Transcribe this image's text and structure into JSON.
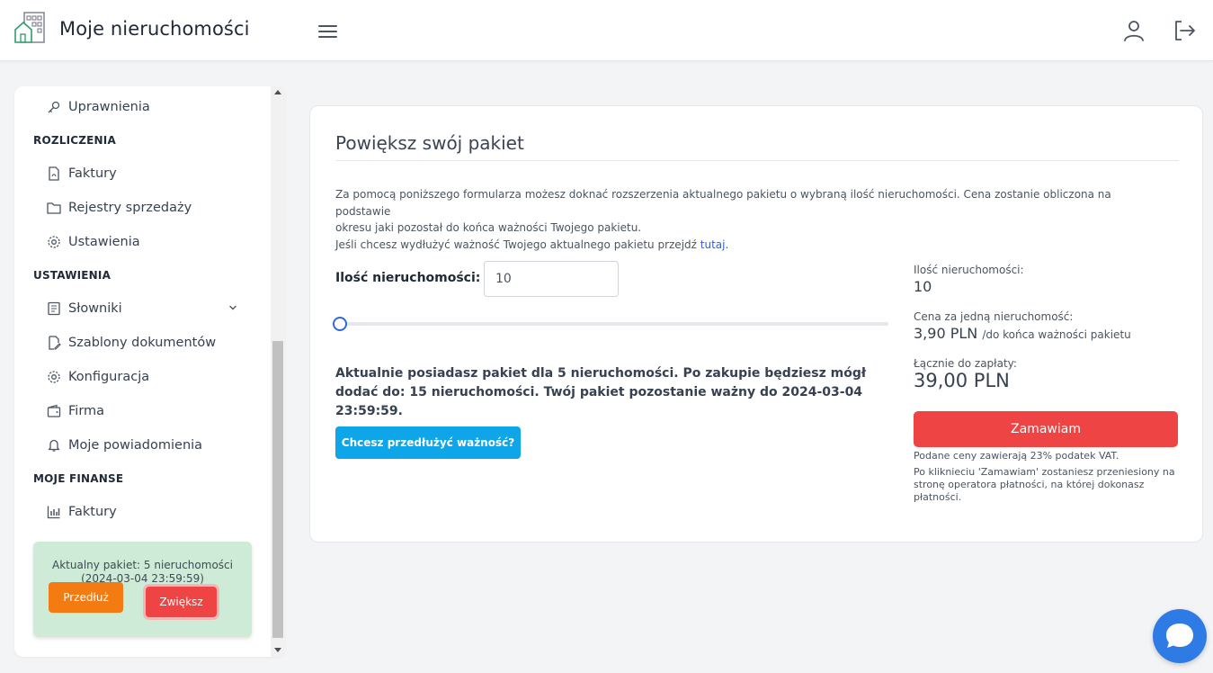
{
  "header": {
    "title": "Moje nieruchomości",
    "icons": [
      "building-logo-icon",
      "hamburger-menu-icon",
      "user-icon",
      "logout-icon"
    ]
  },
  "sidebar": {
    "items_top": [
      {
        "label": "Uprawnienia",
        "icon": "key-icon"
      }
    ],
    "sections": [
      {
        "title": "ROZLICZENIA",
        "items": [
          {
            "label": "Faktury",
            "icon": "pdf-file-icon"
          },
          {
            "label": "Rejestry sprzedaży",
            "icon": "folder-icon"
          },
          {
            "label": "Ustawienia",
            "icon": "gear-icon"
          }
        ]
      },
      {
        "title": "USTAWIENIA",
        "items": [
          {
            "label": "Słowniki",
            "icon": "book-icon"
          },
          {
            "label": "Szablony dokumentów",
            "icon": "document-edit-icon"
          },
          {
            "label": "Konfiguracja",
            "icon": "gear-icon"
          },
          {
            "label": "Firma",
            "icon": "wallet-icon"
          },
          {
            "label": "Moje powiadomienia",
            "icon": "bell-icon"
          }
        ]
      },
      {
        "title": "MOJE FINANSE",
        "items": [
          {
            "label": "Faktury",
            "icon": "bar-chart-icon"
          }
        ]
      }
    ],
    "package": {
      "line1": "Aktualny pakiet: 5 nieruchomości",
      "line2": "(2024-03-04 23:59:59)",
      "extend_label": "Przedłuż",
      "increase_label": "Zwiększ",
      "colors": {
        "extend": "#f47a12",
        "increase": "#ef4444",
        "box": "#cdebd6"
      }
    }
  },
  "main": {
    "title": "Powiększ swój pakiet",
    "desc_line1": "Za pomocą poniższego formularza możesz doknać rozszerzenia aktualnego pakietu o wybraną ilość nieruchomości. Cena zostanie obliczona na podstawie",
    "desc_line2": "okresu jaki pozostał do końca ważności Twojego pakietu.",
    "desc_line3_prefix": "Jeśli chcesz wydłużyć ważność Twojego aktualnego pakietu przejdź ",
    "desc_link": "tutaj",
    "desc_line3_suffix": ".",
    "qty_label": "Ilość nieruchomości:",
    "qty_value": "10",
    "slider_fraction": 0.0,
    "info_text": "Aktualnie posiadasz pakiet dla 5 nieruchomości. Po zakupie będziesz mógł dodać do: 15 nieruchomości. Twój pakiet pozostanie ważny do 2024-03-04 23:59:59.",
    "extend_validity_button": "Chcesz przedłużyć ważność?",
    "summary": {
      "qty_label": "Ilość nieruchomości:",
      "qty_value": "10",
      "unit_price_label": "Cena za jedną nieruchomość:",
      "unit_price_value": "3,90 PLN",
      "unit_price_note": "/do końca ważności pakietu",
      "total_label": "Łącznie do zapłaty:",
      "total_value": "39,00 PLN"
    },
    "order_button": "Zamawiam",
    "vat_note": "Podane ceny zawierają 23% podatek VAT.",
    "redirect_note": "Po kliknieciu 'Zamawiam' zostaniesz przeniesiony na stronę operatora płatności, na której dokonasz płatności.",
    "colors": {
      "accent": "#2f6bd8",
      "order": "#ef4444",
      "cyan": "#0ea5e9"
    }
  },
  "chat": {
    "icon": "chat-bubble-icon",
    "color": "#2f7be6"
  }
}
